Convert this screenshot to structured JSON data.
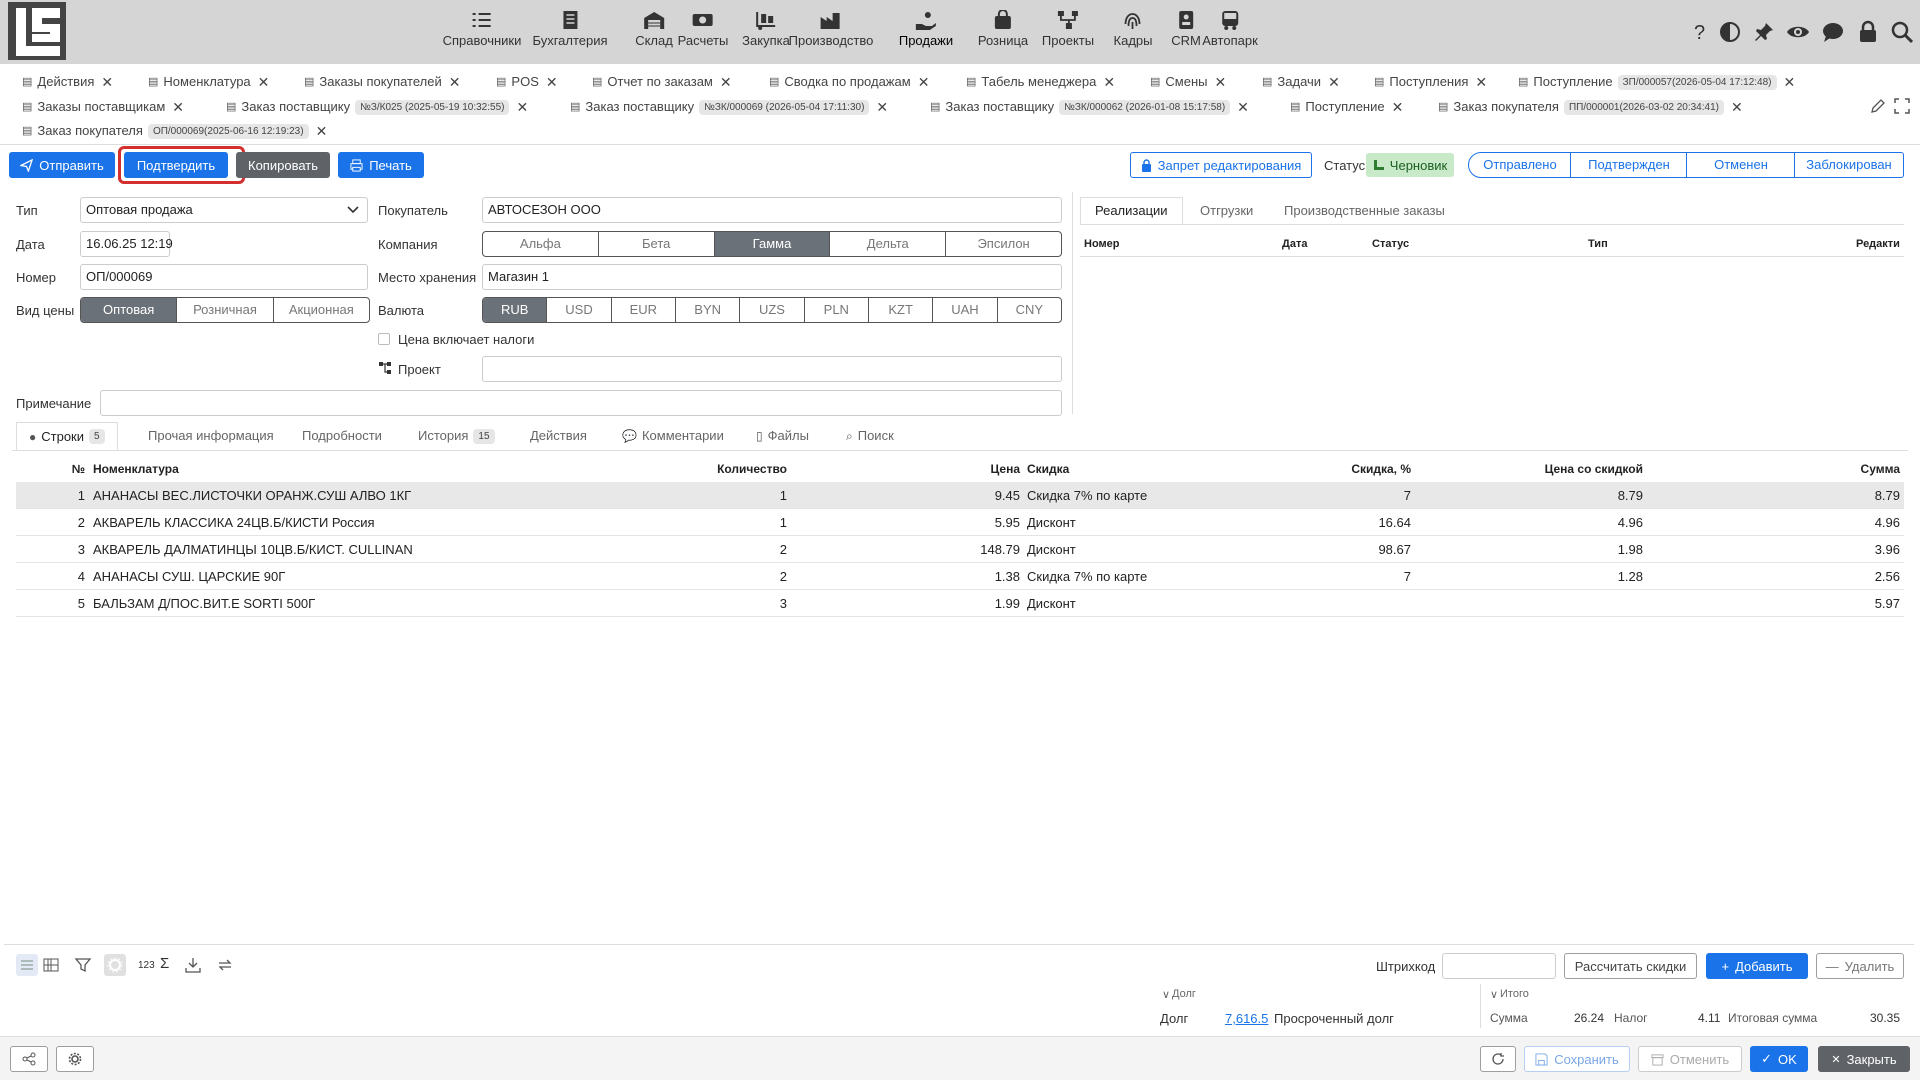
{
  "nav": [
    {
      "label": "Справочники",
      "icon": "list-check-icon"
    },
    {
      "label": "Бухгалтерия",
      "icon": "ledger-icon"
    },
    {
      "label": "Склад",
      "icon": "warehouse-icon"
    },
    {
      "label": "Расчеты",
      "icon": "money-icon"
    },
    {
      "label": "Закупка",
      "icon": "cart-dolly-icon"
    },
    {
      "label": "Производство",
      "icon": "factory-icon"
    },
    {
      "label": "Продажи",
      "icon": "hand-coin-icon"
    },
    {
      "label": "Розница",
      "icon": "bag-icon"
    },
    {
      "label": "Проекты",
      "icon": "project-tree-icon"
    },
    {
      "label": "Кадры",
      "icon": "fingerprint-icon"
    },
    {
      "label": "CRM",
      "icon": "id-card-icon"
    },
    {
      "label": "Автопарк",
      "icon": "bus-icon"
    }
  ],
  "tabs_row1": [
    {
      "label": "Действия",
      "badge": ""
    },
    {
      "label": "Номенклатура",
      "badge": ""
    },
    {
      "label": "Заказы покупателей",
      "badge": ""
    },
    {
      "label": "POS",
      "badge": ""
    },
    {
      "label": "Отчет по заказам",
      "badge": ""
    },
    {
      "label": "Сводка по продажам",
      "badge": ""
    },
    {
      "label": "Табель менеджера",
      "badge": ""
    },
    {
      "label": "Смены",
      "badge": ""
    },
    {
      "label": "Задачи",
      "badge": ""
    },
    {
      "label": "Поступления",
      "badge": ""
    },
    {
      "label": "Поступление",
      "badge": "ЗП/000057(2026-05-04 17:12:48)"
    }
  ],
  "tabs_row2": [
    {
      "label": "Заказы поставщикам",
      "badge": ""
    },
    {
      "label": "Заказ поставщику",
      "badge": "№З/К025 (2025-05-19 10:32:55)"
    },
    {
      "label": "Заказ поставщику",
      "badge": "№ЗК/000069 (2026-05-04 17:11:30)"
    },
    {
      "label": "Заказ поставщику",
      "badge": "№ЗК/000062 (2026-01-08 15:17:58)"
    },
    {
      "label": "Поступление",
      "badge": ""
    },
    {
      "label": "Заказ покупателя",
      "badge": "ПП/000001(2026-03-02 20:34:41)"
    }
  ],
  "tabs_row3": [
    {
      "label": "Заказ покупателя",
      "badge": "ОП/000069(2025-06-16 12:19:23)"
    }
  ],
  "toolbar": {
    "send": "Отправить",
    "confirm": "Подтвердить",
    "copy": "Копировать",
    "print": "Печать",
    "lock_edit": "Запрет редактирования",
    "status_label": "Статус",
    "status_value": "Черновик",
    "stages": [
      "Отправлено",
      "Подтвержден",
      "Отменен",
      "Заблокирован"
    ]
  },
  "form": {
    "type_label": "Тип",
    "type_value": "Оптовая продажа",
    "date_label": "Дата",
    "date_value": "16.06.25 12:19",
    "number_label": "Номер",
    "number_value": "ОП/000069",
    "price_kind_label": "Вид цены",
    "price_kinds": [
      "Оптовая",
      "Розничная",
      "Акционная"
    ],
    "buyer_label": "Покупатель",
    "buyer_value": "АВТОСЕЗОН ООО",
    "company_label": "Компания",
    "companies": [
      "Альфа",
      "Бета",
      "Гамма",
      "Дельта",
      "Эпсилон"
    ],
    "storage_label": "Место хранения",
    "storage_value": "Магазин 1",
    "currency_label": "Валюта",
    "currencies": [
      "RUB",
      "USD",
      "EUR",
      "BYN",
      "UZS",
      "PLN",
      "KZT",
      "UAH",
      "CNY"
    ],
    "tax_label": "Цена включает налоги",
    "project_label": "Проект",
    "note_label": "Примечание"
  },
  "right_panel": {
    "tabs": [
      "Реализации",
      "Отгрузки",
      "Производственные заказы"
    ],
    "headers": [
      "Номер",
      "Дата",
      "Статус",
      "Тип",
      "Редакти"
    ]
  },
  "subtabs": [
    {
      "label": "Строки",
      "count": "5"
    },
    {
      "label": "Прочая информация",
      "count": ""
    },
    {
      "label": "Подробности",
      "count": ""
    },
    {
      "label": "История",
      "count": "15"
    },
    {
      "label": "Действия",
      "count": ""
    },
    {
      "label": "Комментарии",
      "count": ""
    },
    {
      "label": "Файлы",
      "count": ""
    },
    {
      "label": "Поиск",
      "count": ""
    }
  ],
  "table": {
    "headers": {
      "num": "№",
      "item": "Номенклатура",
      "qty": "Количество",
      "price": "Цена",
      "discount": "Скидка",
      "discount_pct": "Скидка, %",
      "price_disc": "Цена со скидкой",
      "sum": "Сумма"
    },
    "rows": [
      {
        "num": "1",
        "item": "АНАНАСЫ ВЕС.ЛИСТОЧКИ ОРАНЖ.СУШ АЛВО 1КГ",
        "qty": "1",
        "price": "9.45",
        "discount": "Скидка 7% по карте",
        "discount_pct": "7",
        "price_disc": "8.79",
        "sum": "8.79"
      },
      {
        "num": "2",
        "item": "АКВАРЕЛЬ КЛАССИКА 24ЦВ.Б/КИСТИ Россия",
        "qty": "1",
        "price": "5.95",
        "discount": "Дисконт",
        "discount_pct": "16.64",
        "price_disc": "4.96",
        "sum": "4.96"
      },
      {
        "num": "3",
        "item": "АКВАРЕЛЬ ДАЛМАТИНЦЫ 10ЦВ.Б/КИСТ. CULLINAN",
        "qty": "2",
        "price": "148.79",
        "discount": "Дисконт",
        "discount_pct": "98.67",
        "price_disc": "1.98",
        "sum": "3.96"
      },
      {
        "num": "4",
        "item": "АНАНАСЫ СУШ. ЦАРСКИЕ 90Г",
        "qty": "2",
        "price": "1.38",
        "discount": "Скидка 7% по карте",
        "discount_pct": "7",
        "price_disc": "1.28",
        "sum": "2.56"
      },
      {
        "num": "5",
        "item": "БАЛЬЗАМ Д/ПОС.ВИТ.Е SORTI 500Г",
        "qty": "3",
        "price": "1.99",
        "discount": "Дисконт",
        "discount_pct": "",
        "price_disc": "",
        "sum": "5.97"
      }
    ]
  },
  "bottom": {
    "sum_icon_text": "123",
    "barcode_label": "Штрихкод",
    "recalc": "Рассчитать скидки",
    "add": "Добавить",
    "delete": "Удалить",
    "debt_section": "Долг",
    "debt_label": "Долг",
    "debt_value": "7,616.5",
    "overdue_label": "Просроченный долг",
    "total_section": "Итого",
    "sum_label": "Сумма",
    "sum_value": "26.24",
    "tax_label": "Налог",
    "tax_value": "4.11",
    "total_label": "Итоговая сумма",
    "total_value": "30.35"
  },
  "footer": {
    "save": "Сохранить",
    "cancel": "Отменить",
    "ok": "OK",
    "close": "Закрыть"
  },
  "colors": {
    "accent": "#1a73e8",
    "highlight": "#d32f2f",
    "topbar": "#d5d5d5",
    "draft": "#c8eac8"
  }
}
